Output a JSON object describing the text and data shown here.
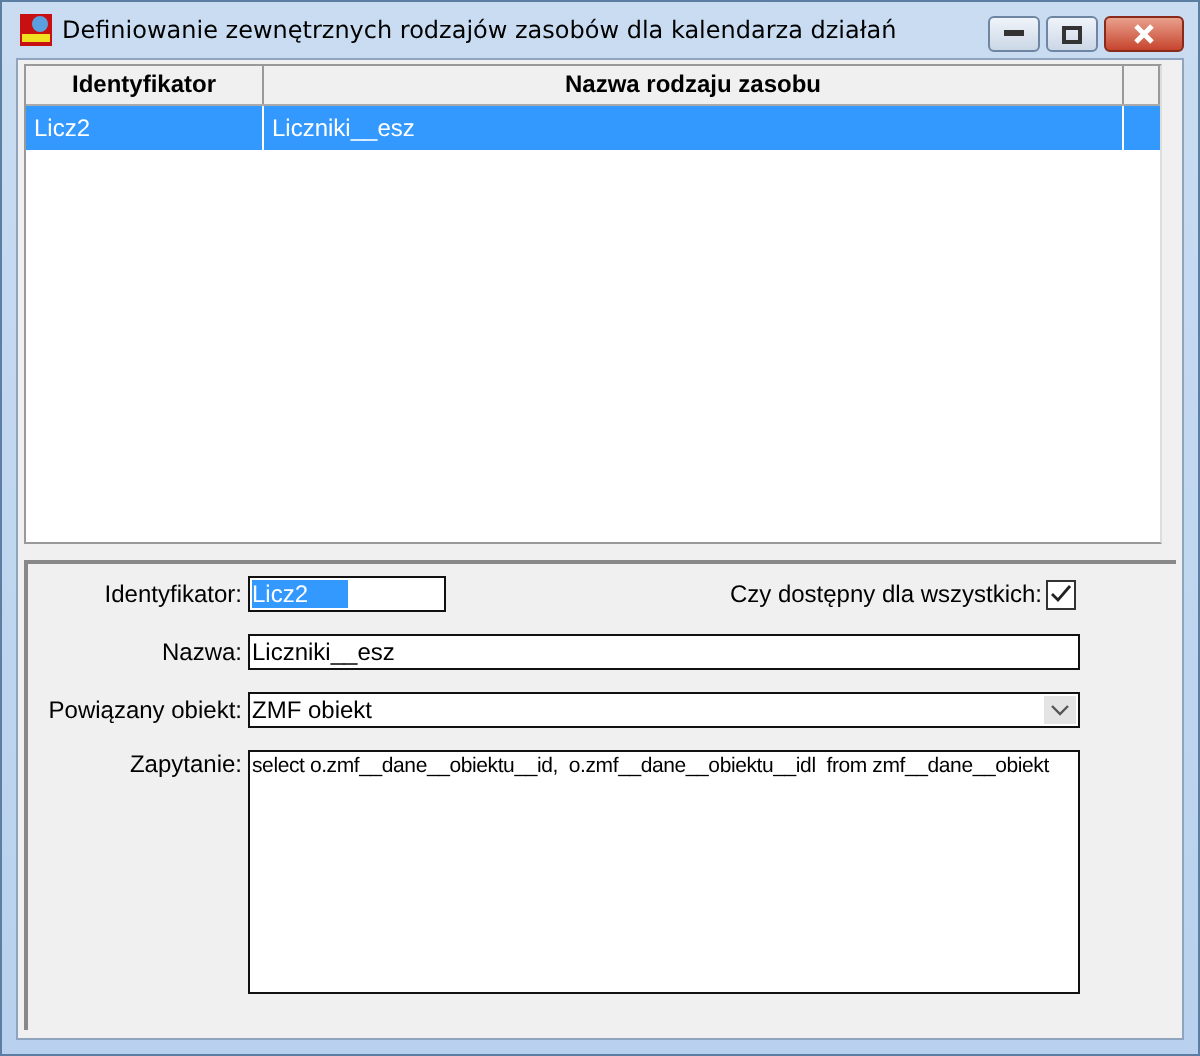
{
  "window": {
    "title": "Definiowanie zewnętrznych rodzajów zasobów dla kalendarza działań"
  },
  "table": {
    "columns": [
      "Identyfikator",
      "Nazwa rodzaju zasobu"
    ],
    "rows": [
      {
        "cells": [
          "Licz2",
          "Liczniki__esz"
        ],
        "selected": true
      }
    ]
  },
  "form": {
    "id_label": "Identyfikator:",
    "id_value": "Licz2",
    "id_text_selected": true,
    "public_label": "Czy dostępny dla wszystkich:",
    "public_checked": true,
    "name_label": "Nazwa:",
    "name_value": "Liczniki__esz",
    "object_label": "Powiązany obiekt:",
    "object_value": "ZMF obiekt",
    "query_label": "Zapytanie:",
    "query_value": "select o.zmf__dane__obiektu__id,  o.zmf__dane__obiektu__idl  from zmf__dane__obiekt"
  }
}
